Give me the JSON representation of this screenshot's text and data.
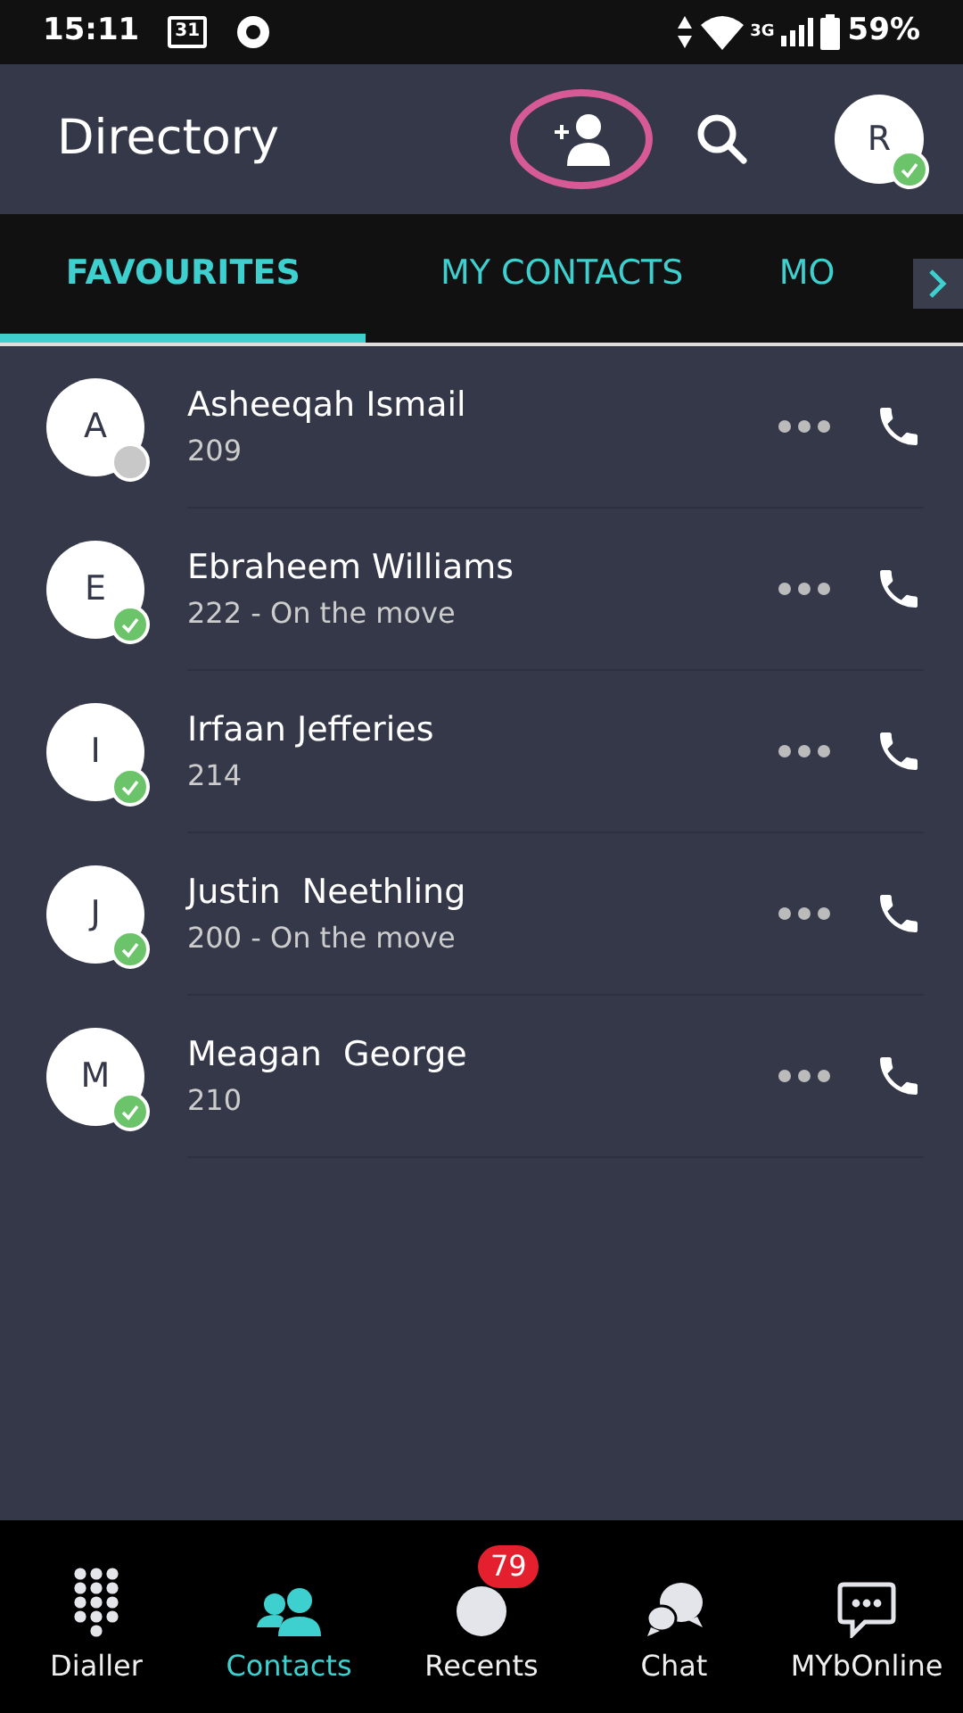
{
  "status_bar": {
    "time": "15:11",
    "calendar_day": "31",
    "network": "3G",
    "battery": "59%"
  },
  "header": {
    "title": "Directory",
    "avatar_initial": "R",
    "avatar_online": true
  },
  "tabs": [
    {
      "label": "FAVOURITES",
      "selected": true
    },
    {
      "label": "MY CONTACTS",
      "selected": false
    },
    {
      "label": "MO",
      "selected": false
    }
  ],
  "contacts": [
    {
      "initial": "A",
      "name": "Asheeqah Ismail",
      "detail": "209",
      "online": false
    },
    {
      "initial": "E",
      "name": "Ebraheem Williams",
      "detail": "222 - On the move",
      "online": true
    },
    {
      "initial": "I",
      "name": "Irfaan Jefferies",
      "detail": "214",
      "online": true
    },
    {
      "initial": "J",
      "name": "Justin  Neethling",
      "detail": "200 - On the move",
      "online": true
    },
    {
      "initial": "M",
      "name": "Meagan  George",
      "detail": "210",
      "online": true
    }
  ],
  "bottom_nav": [
    {
      "kind": "dialpad",
      "label": "Dialler",
      "selected": false
    },
    {
      "kind": "contacts",
      "label": "Contacts",
      "selected": true
    },
    {
      "kind": "recents",
      "label": "Recents",
      "selected": false,
      "badge": "79"
    },
    {
      "kind": "chat",
      "label": "Chat",
      "selected": false
    },
    {
      "kind": "message",
      "label": "MYbOnline",
      "selected": false
    }
  ]
}
